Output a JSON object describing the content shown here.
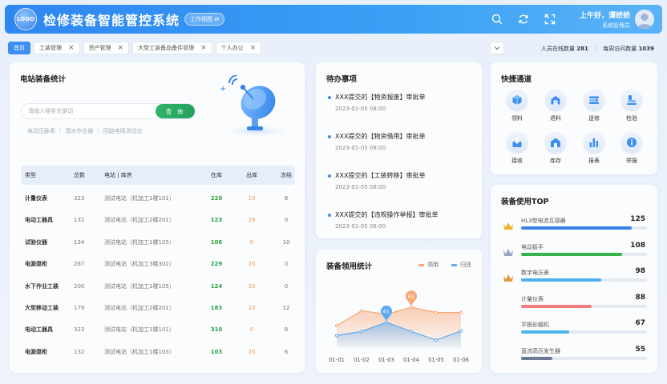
{
  "header": {
    "logo_text": "LOGO",
    "title": "检修装备智能管控系统",
    "view_label": "工作视图 ⇄",
    "greeting": "上午好，谭娇娇",
    "role": "系统管理员"
  },
  "tabs": [
    {
      "label": "首页",
      "active": true,
      "closable": false
    },
    {
      "label": "工装管理",
      "active": false,
      "closable": true
    },
    {
      "label": "资产管理",
      "active": false,
      "closable": true
    },
    {
      "label": "大型工装备品备件管理",
      "active": false,
      "closable": true
    },
    {
      "label": "个人办公",
      "active": false,
      "closable": true
    }
  ],
  "stats": {
    "online_label": "人员在线数量",
    "online_value": "281",
    "visits_label": "每周访问数量",
    "visits_value": "1039"
  },
  "equipment": {
    "title": "电站装备统计",
    "search_placeholder": "请输入搜索关键词",
    "search_button": "查 询",
    "hints": [
      "电动压脉表",
      "潜水作业器",
      "回路电阻测试仪"
    ],
    "columns": [
      "类型",
      "总数",
      "电站 | 库房",
      "在库",
      "出库",
      "冻结"
    ],
    "rows": [
      [
        "计量仪表",
        "323",
        "测试电站（机加工1楼101）",
        "220",
        "10",
        "8"
      ],
      [
        "电动工器具",
        "132",
        "测试电站（机加工2楼201）",
        "123",
        "28",
        "0"
      ],
      [
        "试验仪器",
        "134",
        "测试电站（机加工1楼105）",
        "106",
        "0",
        "10"
      ],
      [
        "电源盘柜",
        "267",
        "测试电站（机加工3楼302）",
        "229",
        "20",
        "0"
      ],
      [
        "水下作业工装",
        "200",
        "测试电站（机加工1楼105）",
        "124",
        "30",
        "0"
      ],
      [
        "大型移动工装",
        "179",
        "测试电站（机加工2楼201）",
        "183",
        "20",
        "12"
      ],
      [
        "电动工器具",
        "323",
        "测试电站（机加工1楼101）",
        "310",
        "0",
        "8"
      ],
      [
        "电源盘柜",
        "132",
        "测试电站（机加工1楼103）",
        "103",
        "20",
        "6"
      ]
    ]
  },
  "todo": {
    "title": "待办事项",
    "items": [
      {
        "text": "XXX提交的【物资报废】审批单",
        "time": "2023-01-05  08:00"
      },
      {
        "text": "XXX提交的【物资借用】审批单",
        "time": "2023-01-05  08:00"
      },
      {
        "text": "XXX提交的【工装转移】审批单",
        "time": "2023-01-05  08:00"
      },
      {
        "text": "XXX提交的【违规操作举报】审批单",
        "time": "2023-01-05  08:00"
      }
    ]
  },
  "chart_data": {
    "type": "area",
    "title": "装备领用统计",
    "categories": [
      "01-01",
      "01-02",
      "01-03",
      "01-04",
      "01-05",
      "01-06"
    ],
    "ylim": [
      0,
      100
    ],
    "grid": false,
    "legend_position": "top-right",
    "series": [
      {
        "name": "领用",
        "color": "#f7a878",
        "values": [
          22,
          48,
          42,
          54,
          45,
          45
        ]
      },
      {
        "name": "归还",
        "color": "#5aa9f0",
        "values": [
          5,
          12,
          28,
          12,
          -3,
          13
        ]
      }
    ],
    "annotations": [
      {
        "series": "领用",
        "x": "01-04",
        "label": "62"
      },
      {
        "series": "归还",
        "x": "01-03",
        "label": "61"
      }
    ]
  },
  "quick": {
    "title": "快捷通道",
    "items": [
      {
        "label": "领料",
        "icon": "cube-icon"
      },
      {
        "label": "退料",
        "icon": "return-box-icon"
      },
      {
        "label": "送修",
        "icon": "tools-icon"
      },
      {
        "label": "检验",
        "icon": "inspect-icon"
      },
      {
        "label": "接收",
        "icon": "receive-icon"
      },
      {
        "label": "库存",
        "icon": "warehouse-icon"
      },
      {
        "label": "报表",
        "icon": "bar-chart-icon"
      },
      {
        "label": "举报",
        "icon": "info-icon"
      }
    ]
  },
  "top": {
    "title": "装备使用TOP",
    "items": [
      {
        "name": "HL3型电流互感器",
        "value": "125",
        "fraction": 0.88,
        "color": "#3a7ee8"
      },
      {
        "name": "电动扳手",
        "value": "108",
        "fraction": 0.8,
        "color": "#34b44a"
      },
      {
        "name": "数字电压表",
        "value": "98",
        "fraction": 0.64,
        "color": "#4bb4ee"
      },
      {
        "name": "计量仪表",
        "value": "88",
        "fraction": 0.56,
        "color": "#f07c7c"
      },
      {
        "name": "平板砂磨机",
        "value": "67",
        "fraction": 0.38,
        "color": "#4bb4ee"
      },
      {
        "name": "直流高压发生器",
        "value": "55",
        "fraction": 0.25,
        "color": "#6c7a93"
      }
    ]
  }
}
